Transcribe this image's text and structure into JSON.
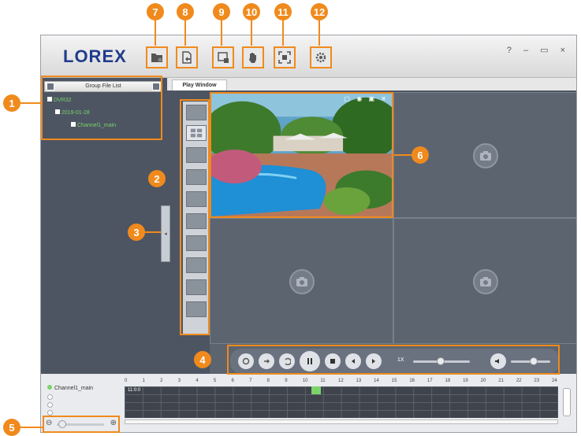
{
  "app": {
    "brand": "LOREX",
    "window_controls": "? – ▭ ×"
  },
  "toolbar": {
    "buttons": [
      {
        "id": 7,
        "icon": "folder-icon"
      },
      {
        "id": 8,
        "icon": "export-icon"
      },
      {
        "id": 9,
        "icon": "snapshot-icon"
      },
      {
        "id": 10,
        "icon": "hand-icon"
      },
      {
        "id": 11,
        "icon": "fullscreen-icon"
      },
      {
        "id": 12,
        "icon": "gear-icon"
      }
    ]
  },
  "left_panel": {
    "group_header": "Group File List",
    "tree": {
      "root": "DVR32",
      "date": "2019-01-28",
      "channel": "Channel1_main"
    }
  },
  "play_window": {
    "tab_label": "Play Window"
  },
  "playback": {
    "speed": "1X"
  },
  "timeline": {
    "channel": "Channel1_main",
    "hours": [
      "0",
      "1",
      "2",
      "3",
      "4",
      "5",
      "6",
      "7",
      "8",
      "9",
      "10",
      "11",
      "12",
      "13",
      "14",
      "15",
      "16",
      "17",
      "18",
      "19",
      "20",
      "21",
      "22",
      "23",
      "24"
    ],
    "current_time": "11:0:0"
  },
  "callouts": [
    "1",
    "2",
    "3",
    "4",
    "5",
    "6",
    "7",
    "8",
    "9",
    "10",
    "11",
    "12"
  ],
  "colors": {
    "accent": "#f08a1c",
    "brand": "#1f3c8c",
    "tree_text": "#7cd46b"
  }
}
